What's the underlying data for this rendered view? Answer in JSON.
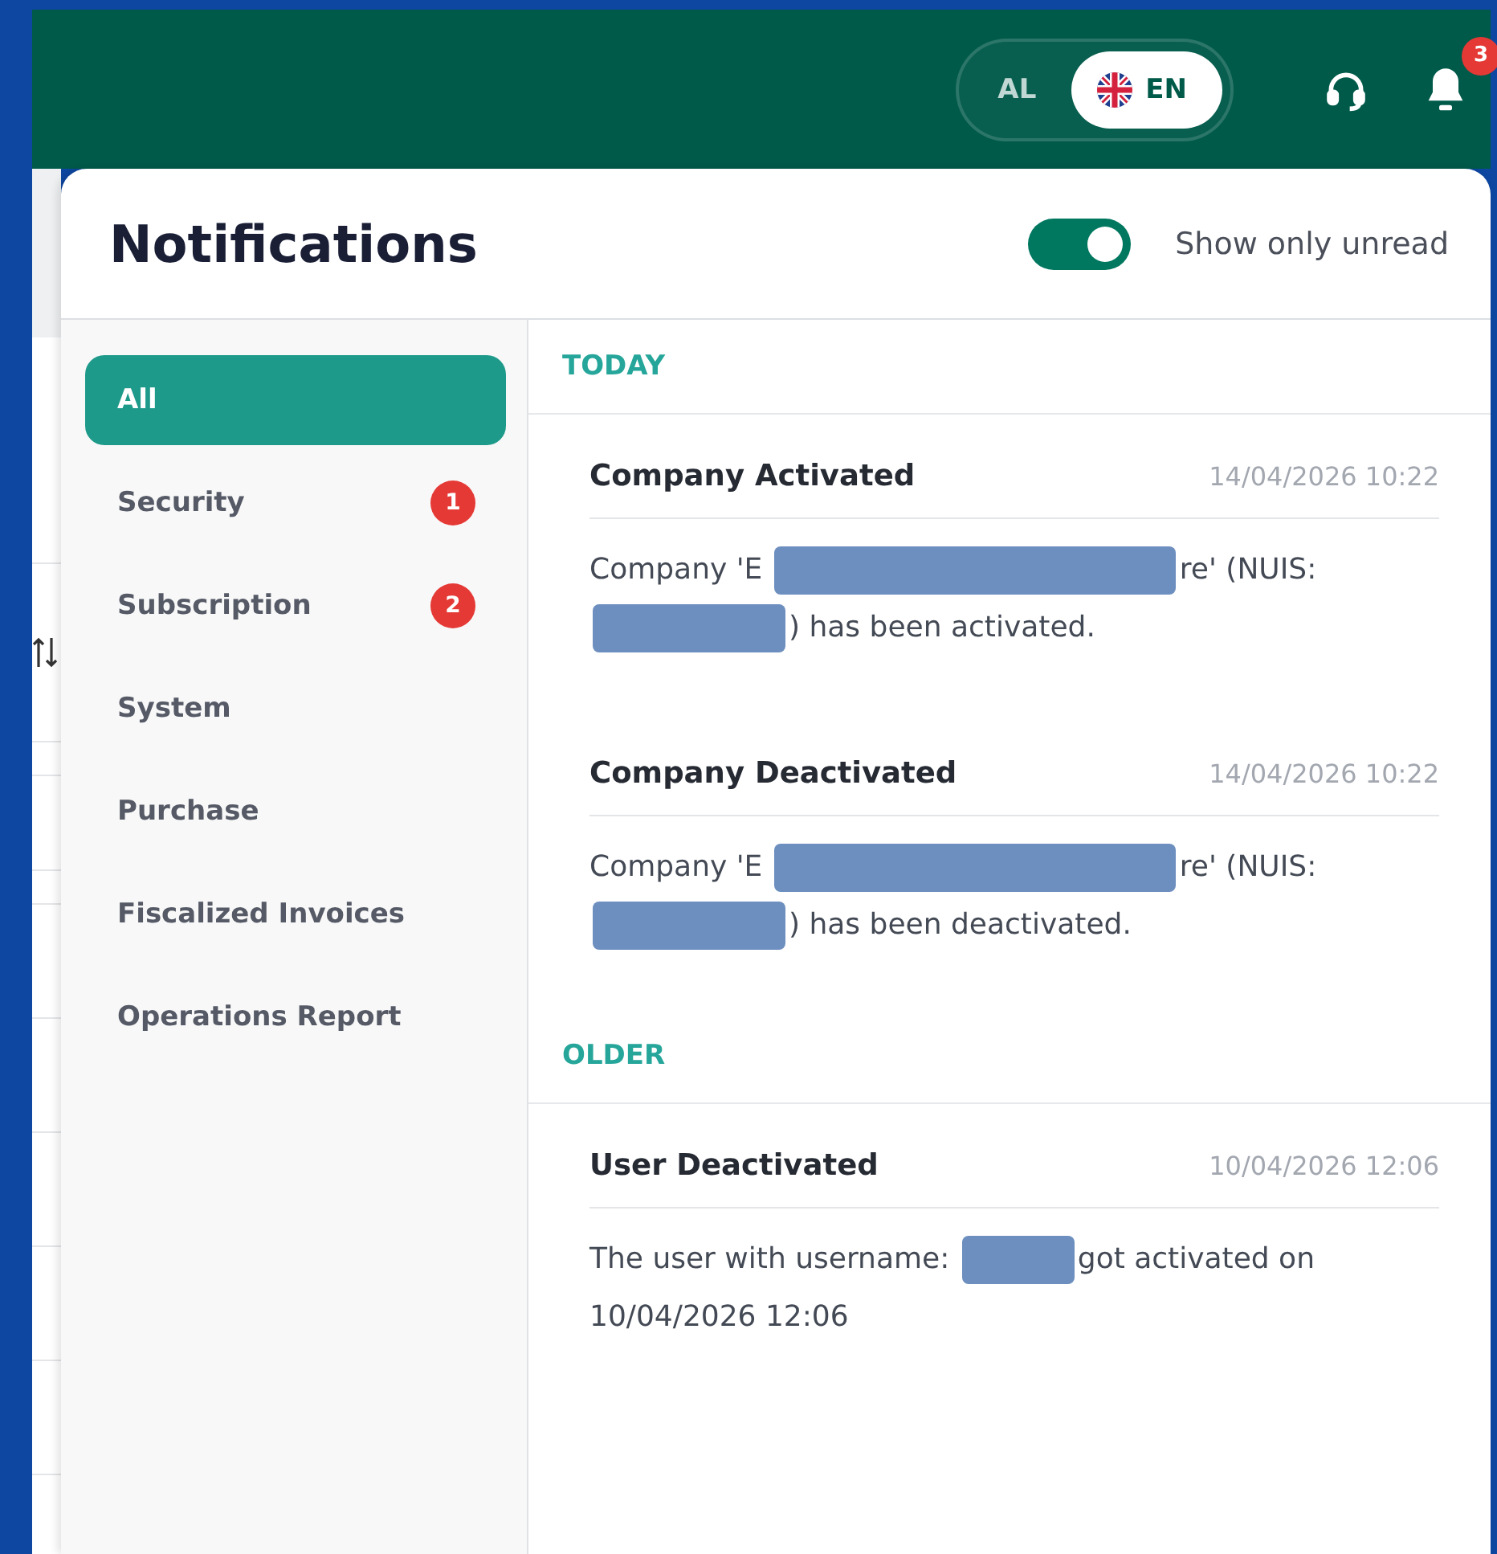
{
  "header": {
    "languages": [
      {
        "label": "AL",
        "selected": false,
        "flag": false
      },
      {
        "label": "EN",
        "selected": true,
        "flag": true
      }
    ],
    "notification_count": "3"
  },
  "panel": {
    "title": "Notifications",
    "toggle": {
      "label": "Show only unread",
      "on": true
    }
  },
  "categories": [
    {
      "label": "All",
      "selected": true
    },
    {
      "label": "Security",
      "selected": false,
      "badge": "1"
    },
    {
      "label": "Subscription",
      "selected": false,
      "badge": "2"
    },
    {
      "label": "System",
      "selected": false
    },
    {
      "label": "Purchase",
      "selected": false
    },
    {
      "label": "Fiscalized Invoices",
      "selected": false
    },
    {
      "label": "Operations Report",
      "selected": false
    }
  ],
  "sections": [
    {
      "heading": "TODAY",
      "items": [
        {
          "title": "Company Activated",
          "time": "14/04/2026 10:22",
          "message": [
            {
              "kind": "text",
              "text": "Company 'E"
            },
            {
              "kind": "redacted"
            },
            {
              "kind": "text",
              "text": "re' (NUIS:"
            },
            {
              "kind": "break"
            },
            {
              "kind": "redacted"
            },
            {
              "kind": "text",
              "text": ") has been activated."
            }
          ]
        },
        {
          "title": "Company Deactivated",
          "time": "14/04/2026 10:22",
          "message": [
            {
              "kind": "text",
              "text": "Company 'E"
            },
            {
              "kind": "redacted"
            },
            {
              "kind": "text",
              "text": "re' (NUIS:"
            },
            {
              "kind": "break"
            },
            {
              "kind": "redacted"
            },
            {
              "kind": "text",
              "text": ") has been deactivated."
            }
          ]
        }
      ]
    },
    {
      "heading": "OLDER",
      "items": [
        {
          "title": "User Deactivated",
          "time": "10/04/2026 12:06",
          "message": [
            {
              "kind": "text",
              "text": "The user with username:"
            },
            {
              "kind": "redacted"
            },
            {
              "kind": "text",
              "text": "got activated on"
            },
            {
              "kind": "break"
            },
            {
              "kind": "text",
              "text": "10/04/2026 12:06"
            }
          ]
        }
      ]
    }
  ]
}
